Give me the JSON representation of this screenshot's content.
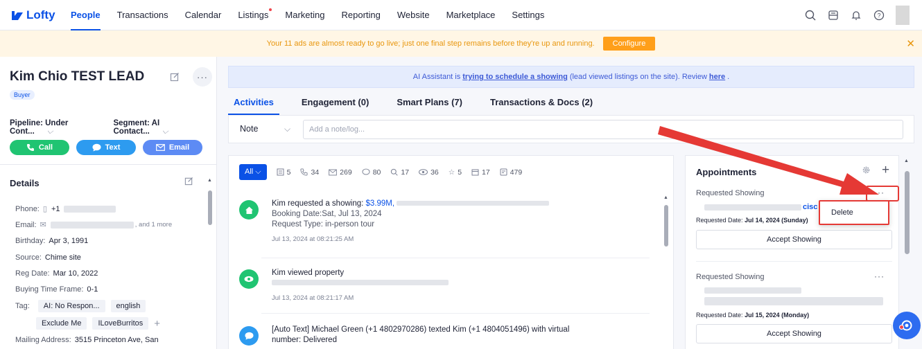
{
  "nav": {
    "brand": "Lofty",
    "items": [
      "People",
      "Transactions",
      "Calendar",
      "Listings",
      "Marketing",
      "Reporting",
      "Website",
      "Marketplace",
      "Settings"
    ],
    "active": "People"
  },
  "banner": {
    "text": "Your 11 ads are almost ready to go live; just one final step remains before they're up and running.",
    "button": "Configure"
  },
  "lead": {
    "name": "Kim Chio TEST LEAD",
    "badge": "Buyer",
    "pipeline": "Pipeline: Under Cont...",
    "segment": "Segment: AI Contact...",
    "call": "Call",
    "text": "Text",
    "email": "Email"
  },
  "details": {
    "title": "Details",
    "phone_label": "Phone:",
    "phone_value": "+1",
    "email_label": "Email:",
    "email_more": ", and 1 more",
    "birthday_label": "Birthday:",
    "birthday_value": "Apr 3, 1991",
    "source_label": "Source:",
    "source_value": "Chime site",
    "regdate_label": "Reg Date:",
    "regdate_value": "Mar 10, 2022",
    "timeframe_label": "Buying Time Frame:",
    "timeframe_value": "0-1",
    "tag_label": "Tag:",
    "tags": [
      "AI: No Respon...",
      "english",
      "Exclude Me",
      "ILoveBurritos"
    ],
    "mailing_label": "Mailing Address:",
    "mailing_value": "3515 Princeton Ave, San"
  },
  "ai_bar": {
    "prefix": "AI Assistant is",
    "link": "trying to schedule a showing",
    "middle": "(lead viewed listings on the site). Review",
    "here": "here",
    "end": "."
  },
  "tabs": [
    "Activities",
    "Engagement (0)",
    "Smart Plans (7)",
    "Transactions & Docs (2)"
  ],
  "note": {
    "type": "Note",
    "placeholder": "Add a note/log..."
  },
  "filters": {
    "all": "All",
    "counts": [
      "5",
      "34",
      "269",
      "80",
      "17",
      "36",
      "5",
      "17",
      "479"
    ]
  },
  "activities": [
    {
      "line1_prefix": "Kim requested a showing:",
      "line1_price": "$3.99M,",
      "line2": "Booking Date:Sat, Jul 13, 2024",
      "line3": "Request Type: in-person tour",
      "time": "Jul 13, 2024 at 08:21:25 AM"
    },
    {
      "line1": "Kim viewed property",
      "time": "Jul 13, 2024 at 08:21:17 AM"
    },
    {
      "line1": "[Auto Text] Michael Green (+1 4802970286) texted Kim (+1 4804051496) with virtual",
      "line2": "number: Delivered"
    }
  ],
  "appointments": {
    "title": "Appointments",
    "items": [
      {
        "status": "Requested Showing",
        "address_tail": "cisc",
        "date_label": "Requested Date:",
        "date": "Jul 14, 2024 (Sunday)",
        "button": "Accept Showing"
      },
      {
        "status": "Requested Showing",
        "date_label": "Requested Date:",
        "date": "Jul 15, 2024 (Monday)",
        "button": "Accept Showing"
      }
    ],
    "menu_delete": "Delete"
  },
  "colors": {
    "brand": "#0a51e6",
    "banner_text": "#e8960d",
    "call": "#20c472",
    "text": "#2d9bf0",
    "email": "#5d8bf4",
    "annotation": "#e53935"
  }
}
